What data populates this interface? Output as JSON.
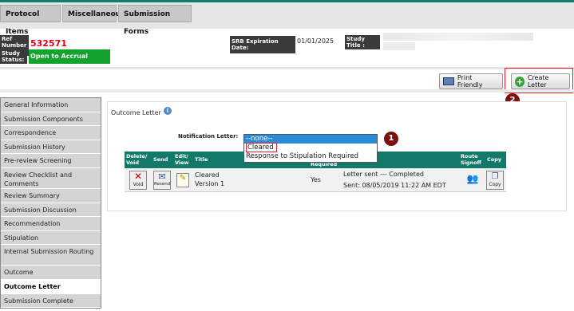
{
  "tabs": [
    "Protocol Items",
    "Miscellaneous",
    "Submission Forms"
  ],
  "header": {
    "ref_label": "Ref Number :",
    "ref_value": "532571",
    "status_label": "Study Status:",
    "status_value": "Open to Accrual",
    "srb_label": "SRB Expiration Date:",
    "srb_value": "01/01/2025",
    "title_label": "Study Title :"
  },
  "toolbar": {
    "print_label": "Print Friendly",
    "create_label": "Create Letter"
  },
  "callouts": [
    "1",
    "2"
  ],
  "sidebar": {
    "items": [
      "General Information",
      "Submission Components",
      "Correspondence",
      "Submission History",
      "Pre-review Screening",
      "Review Checklist and Comments",
      "Review Summary",
      "Submission Discussion",
      "Recommendation",
      "Stipulation",
      "Internal Submission Routing",
      "Outcome",
      "Outcome Letter",
      "Submission Complete"
    ],
    "active": "Outcome Letter"
  },
  "panel": {
    "title": "Outcome Letter",
    "notification_label": "Notification Letter:",
    "dropdown_options": [
      "--none--",
      "Cleared",
      "Response to Stipulation Required"
    ],
    "dropdown_selected": "--none--"
  },
  "table": {
    "headers": {
      "delete_void": "Delete/ Void",
      "send": "Send",
      "edit_view": "Edit/ View",
      "title": "Title",
      "required": "Required",
      "route_signoff": "Route Signoff",
      "copy": "Copy"
    },
    "row": {
      "void_label": "Void",
      "resend_label": "Resend",
      "title": "Cleared",
      "version": "Version 1",
      "required": "Yes",
      "status": "Letter sent --- Completed",
      "sent": "Sent: 08/05/2019 11:22 AM EDT",
      "copy_label": "Copy"
    }
  },
  "colors": {
    "accent": "#137a6a",
    "status_green": "#13a22c",
    "ref_red": "#e0001a",
    "highlight": "#e0202a"
  }
}
